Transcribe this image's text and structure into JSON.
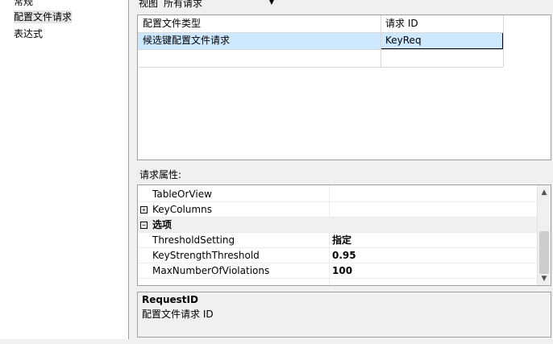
{
  "nav": {
    "items": [
      {
        "label": "常规"
      },
      {
        "label": "配置文件请求"
      },
      {
        "label": "表达式"
      }
    ]
  },
  "view": {
    "label": "视图",
    "selected": "所有请求"
  },
  "grid": {
    "columns": [
      "配置文件类型",
      "请求 ID"
    ],
    "rows": [
      {
        "type": "候选键配置文件请求",
        "id": "KeyReq"
      }
    ]
  },
  "properties": {
    "label": "请求属性:",
    "rows": [
      {
        "name": "TableOrView",
        "value": ""
      },
      {
        "name": "KeyColumns",
        "value": ""
      },
      {
        "name": "选项",
        "value": ""
      },
      {
        "name": "ThresholdSetting",
        "value": "指定"
      },
      {
        "name": "KeyStrengthThreshold",
        "value": "0.95"
      },
      {
        "name": "MaxNumberOfViolations",
        "value": "100"
      }
    ]
  },
  "description": {
    "title": "RequestID",
    "text": "配置文件请求 ID"
  },
  "colors": {
    "selection": "#cde8ff",
    "selection_border": "#000000",
    "category_bg": "#f0f0f0"
  }
}
